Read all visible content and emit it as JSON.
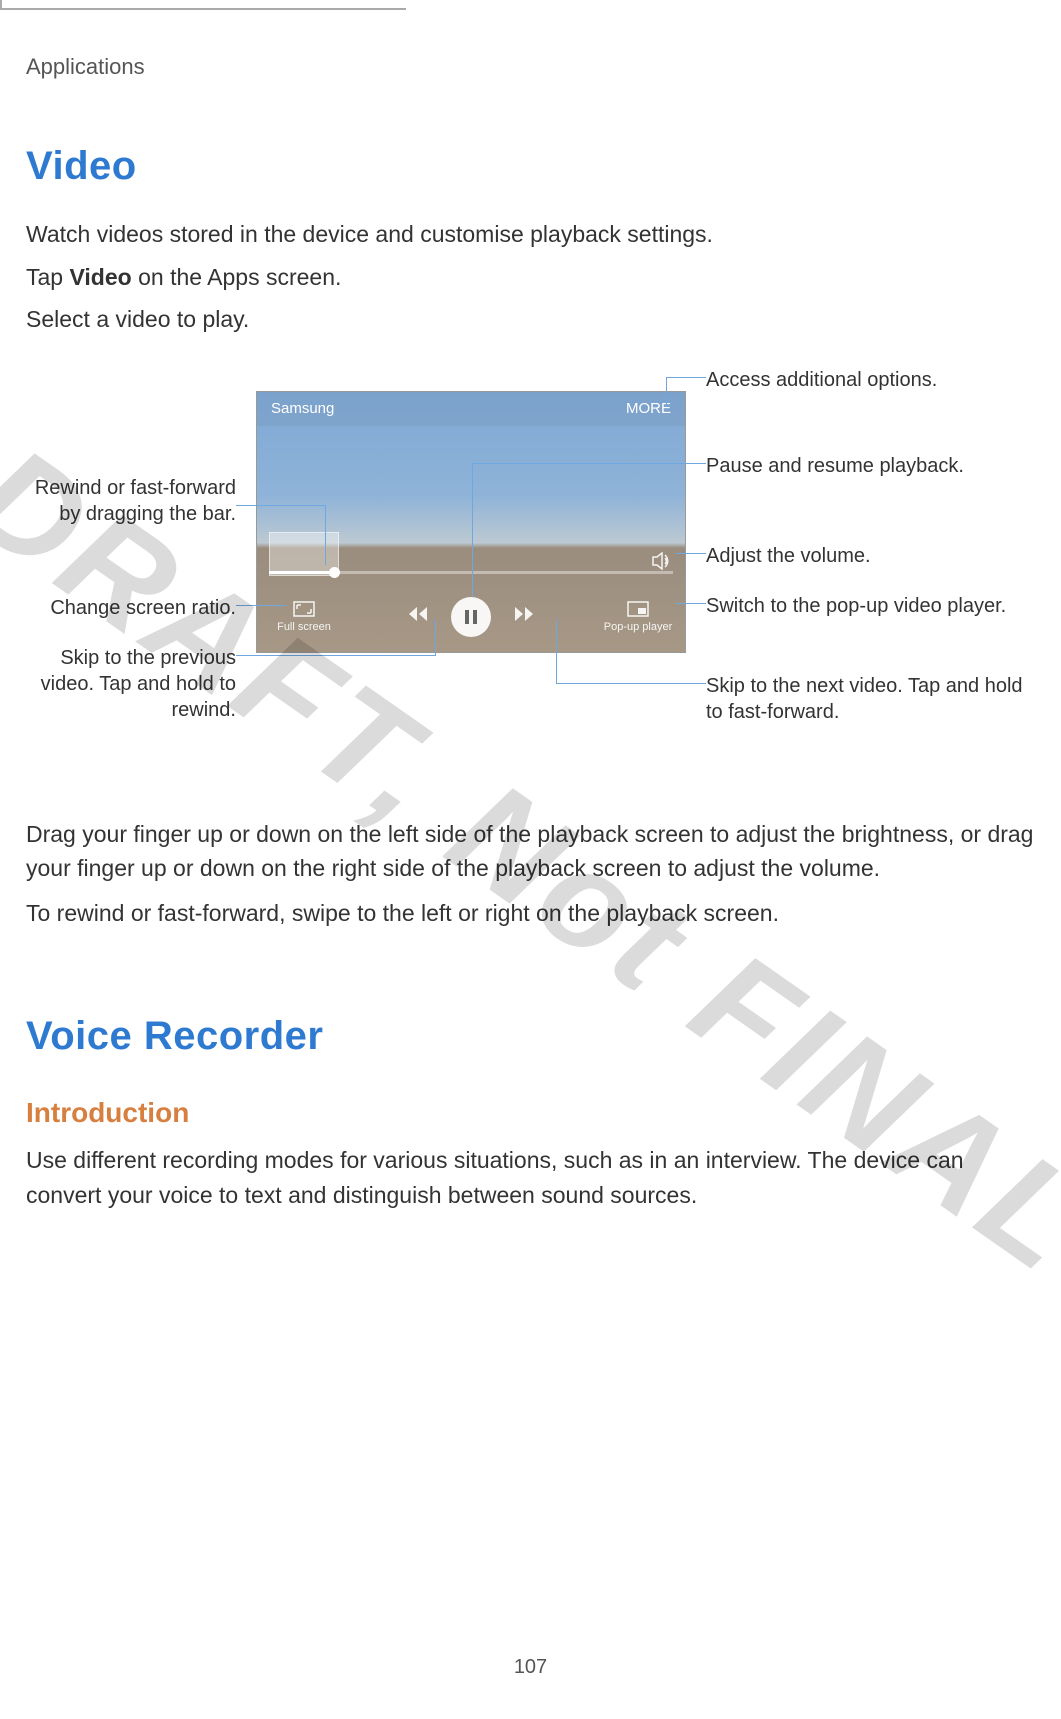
{
  "chapter": "Applications",
  "section_video": "Video",
  "video_intro": "Watch videos stored in the device and customise playback settings.",
  "video_tap_pre": "Tap ",
  "video_tap_bold": "Video",
  "video_tap_post": " on the Apps screen.",
  "video_select": "Select a video to play.",
  "screenshot": {
    "title": "Samsung",
    "more": "MORE",
    "fullscreen": "Full screen",
    "popup": "Pop-up player"
  },
  "callouts": {
    "rewind_bar": "Rewind or fast-forward by dragging the bar.",
    "change_ratio": "Change screen ratio.",
    "skip_prev": "Skip to the previous video. Tap and hold to rewind.",
    "access_more": "Access additional options.",
    "pause_resume": "Pause and resume playback.",
    "adjust_volume": "Adjust the volume.",
    "switch_popup": "Switch to the pop-up video player.",
    "skip_next": "Skip to the next video. Tap and hold to fast-forward."
  },
  "video_drag": "Drag your finger up or down on the left side of the playback screen to adjust the brightness, or drag your finger up or down on the right side of the playback screen to adjust the volume.",
  "video_swipe": "To rewind or fast-forward, swipe to the left or right on the playback screen.",
  "section_voice": "Voice Recorder",
  "voice_sub": "Introduction",
  "voice_intro": "Use different recording modes for various situations, such as in an interview. The device can convert your voice to text and distinguish between sound sources.",
  "watermark": "DRAFT,  Not  FINAL",
  "page_number": "107"
}
